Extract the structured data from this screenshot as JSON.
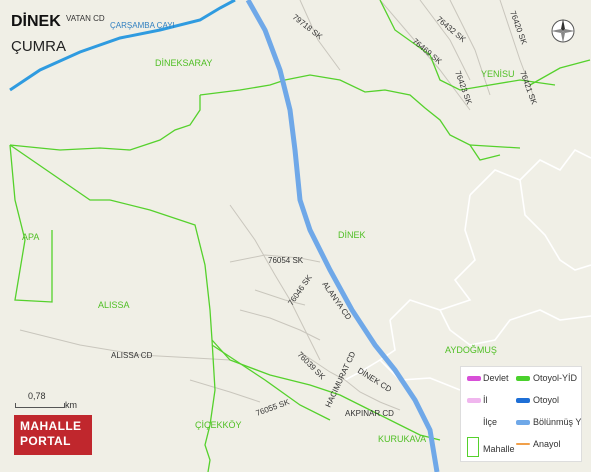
{
  "map": {
    "title": "DİNEK",
    "subtitle": "ÇUMRA",
    "compass_icon": "compass-rose-icon",
    "scale": {
      "value": "0,78",
      "unit": "km"
    },
    "logo": {
      "line1": "MAHALLE",
      "line2": "PORTAL"
    },
    "colors": {
      "background": "#f0efe6",
      "mahalle_border": "#55d12c",
      "otoyol": "#1e88e5",
      "bolunmus_yol": "#6fa8e8",
      "anayol": "#f1a04a",
      "devlet": "#d84fd8",
      "il": "#f0b6ee"
    },
    "neighborhood_labels": [
      "DİNEKSARAY",
      "YENİSU",
      "APA",
      "DİNEK",
      "ALISSA",
      "AYDOĞMUŞ",
      "ÇİÇEKKÖY",
      "KURUKAVA"
    ],
    "street_labels": [
      "VATAN CD",
      "ÇARŞAMBA ÇAYI",
      "79718 SK",
      "76432 SK",
      "76420 SK",
      "76469 SK",
      "76423 SK",
      "76421 SK",
      "76054 SK",
      "76046 SK",
      "ALANYA CD",
      "ALISSA CD",
      "76039 SK",
      "HACIMURAT CD",
      "DİNEK CD",
      "76055 SK",
      "AKPINAR CD"
    ],
    "legend": [
      {
        "label": "Devlet",
        "color": "#d84fd8"
      },
      {
        "label": "İl",
        "color": "#f0b6ee"
      },
      {
        "label": "İlçe",
        "color": ""
      },
      {
        "label": "Mahalle",
        "color": "#55d12c"
      },
      {
        "label": "Otoyol-YİD",
        "color": "#4ad12c"
      },
      {
        "label": "Otoyol",
        "color": "#1e6fd6"
      },
      {
        "label": "Bölünmüş Y",
        "color": "#6fa8e8"
      },
      {
        "label": "Anayol",
        "color": "#f1a04a"
      }
    ]
  }
}
